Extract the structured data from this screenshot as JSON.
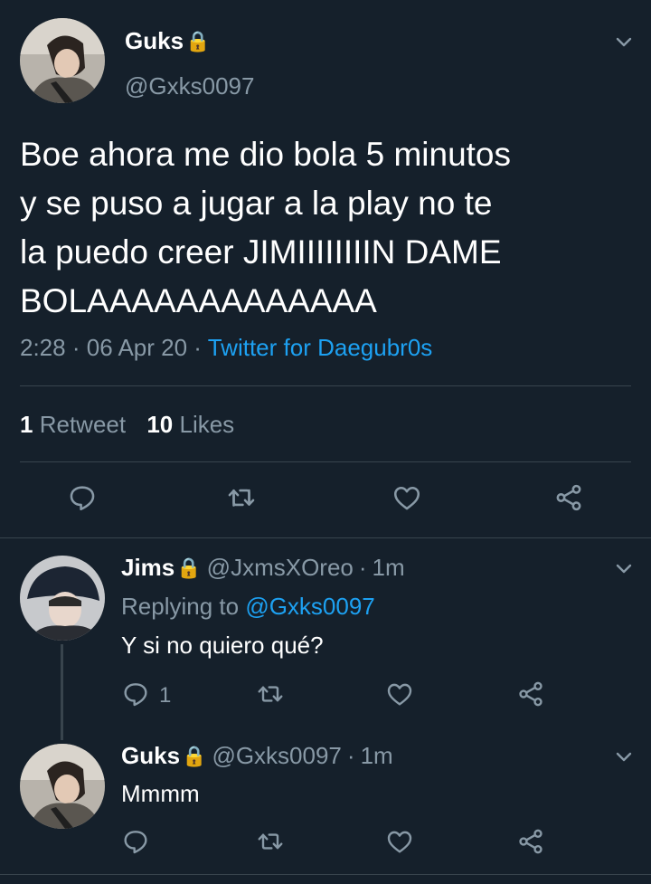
{
  "main_tweet": {
    "display_name": "Guks",
    "lock": "🔒",
    "handle": "@Gxks0097",
    "text_lines": [
      "Boe ahora me dio bola 5 minutos",
      "y se puso a jugar a la play no te",
      "la puedo creer JIMIIIIIIIIN DAME",
      "BOLAAAAAAAAAAAAA"
    ],
    "time": "2:28",
    "dot": "·",
    "date": "06 Apr 20",
    "source": "Twitter for Daegubr0s",
    "retweets_count": "1",
    "retweets_label": "Retweet",
    "likes_count": "10",
    "likes_label": "Likes"
  },
  "reply1": {
    "display_name": "Jims",
    "lock": "🔒",
    "handle": "@JxmsXOreo",
    "dot": "·",
    "age": "1m",
    "replying_prefix": "Replying to",
    "replying_handle": "@Gxks0097",
    "text": "Y si no quiero qué?",
    "reply_count": "1"
  },
  "reply2": {
    "display_name": "Guks",
    "lock": "🔒",
    "handle": "@Gxks0097",
    "dot": "·",
    "age": "1m",
    "text": "Mmmm"
  },
  "colors": {
    "background": "#15202b",
    "secondary_text": "#8899a6",
    "link": "#1da1f2",
    "divider": "#38444d"
  }
}
